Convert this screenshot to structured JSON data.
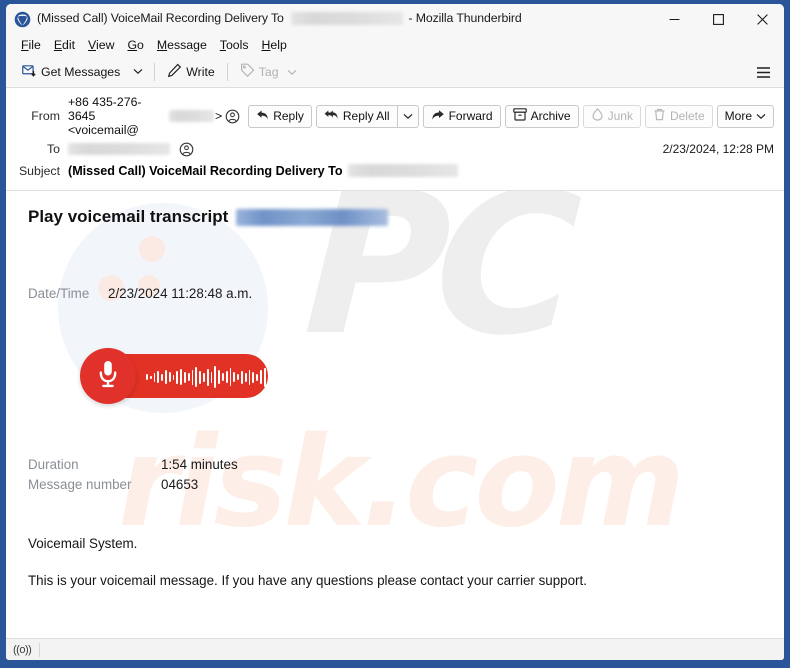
{
  "window": {
    "title_prefix": "(Missed Call) VoiceMail Recording Delivery To",
    "title_suffix": "- Mozilla Thunderbird",
    "app_icon": "thunderbird-logo",
    "controls": {
      "minimize": "minimize-icon",
      "maximize": "maximize-icon",
      "close": "close-icon"
    },
    "frame_color": "#2a5699"
  },
  "menubar": {
    "items": [
      {
        "label": "File",
        "accel": "F"
      },
      {
        "label": "Edit",
        "accel": "E"
      },
      {
        "label": "View",
        "accel": "V"
      },
      {
        "label": "Go",
        "accel": "G"
      },
      {
        "label": "Message",
        "accel": "M"
      },
      {
        "label": "Tools",
        "accel": "T"
      },
      {
        "label": "Help",
        "accel": "H"
      }
    ]
  },
  "toolbar": {
    "get_messages_label": "Get Messages",
    "write_label": "Write",
    "tag_label": "Tag",
    "tag_disabled": true,
    "app_menu_icon": "hamburger-icon"
  },
  "message_header": {
    "from_label": "From",
    "from_value_prefix": "+86 435-276-3645 <voicemail@",
    "from_value_suffix": ">",
    "to_label": "To",
    "subject_label": "Subject",
    "subject_value": "(Missed Call) VoiceMail Recording Delivery To",
    "date": "2/23/2024, 12:28 PM",
    "actions": [
      {
        "name": "reply",
        "label": "Reply",
        "icon": "reply-icon",
        "disabled": false
      },
      {
        "name": "reply-all",
        "label": "Reply All",
        "icon": "reply-all-icon",
        "disabled": false
      },
      {
        "name": "forward",
        "label": "Forward",
        "icon": "forward-icon",
        "disabled": false
      },
      {
        "name": "archive",
        "label": "Archive",
        "icon": "archive-icon",
        "disabled": false
      },
      {
        "name": "junk",
        "label": "Junk",
        "icon": "junk-icon",
        "disabled": true
      },
      {
        "name": "delete",
        "label": "Delete",
        "icon": "trash-icon",
        "disabled": true
      },
      {
        "name": "more",
        "label": "More",
        "icon": "chevron-down-icon",
        "disabled": false
      }
    ]
  },
  "email_body": {
    "heading": "Play voicemail transcript",
    "datetime_label": "Date/Time",
    "datetime_value": "2/23/2024 11:28:48 a.m.",
    "player": {
      "mic_icon": "microphone-icon",
      "accent_color": "#e0312a",
      "waveform": [
        6,
        3,
        9,
        12,
        7,
        14,
        10,
        5,
        13,
        16,
        11,
        8,
        15,
        20,
        13,
        9,
        17,
        11,
        22,
        14,
        8,
        12,
        18,
        10,
        6,
        13,
        9,
        15,
        11,
        7,
        14,
        19,
        12,
        8,
        16,
        10,
        13,
        7,
        11,
        15,
        9,
        12,
        6,
        14,
        10,
        8,
        12,
        5,
        9,
        4,
        7,
        3
      ]
    },
    "duration_label": "Duration",
    "duration_value": "1:54 minutes",
    "message_number_label": "Message number",
    "message_number_value": "04653",
    "signature": "Voicemail System.",
    "closing": "This is your voicemail message. If you have any questions please contact your carrier support."
  },
  "watermark": {
    "text_top": "PC",
    "text_bottom": "risk.com"
  },
  "statusbar": {
    "icon": "((o))"
  }
}
